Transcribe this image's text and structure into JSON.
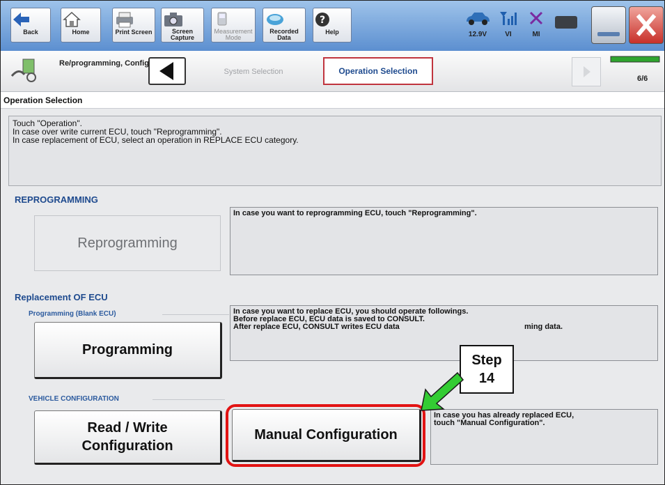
{
  "toolbar": {
    "back_label": "Back",
    "home_label": "Home",
    "print_screen_label": "Print Screen",
    "screen_capture_label": "Screen Capture",
    "measurement_mode_label": "Measurement Mode",
    "recorded_data_label": "Recorded Data",
    "help_label": "Help",
    "battery_voltage": "12.9V",
    "vi_label": "VI",
    "mi_label": "MI"
  },
  "nav": {
    "title": "Re/programming, Configuration",
    "breadcrumb_system": "System Selection",
    "breadcrumb_operation": "Operation Selection",
    "page_indicator": "6/6"
  },
  "section_title": "Operation Selection",
  "instructions": [
    "Touch \"Operation\".",
    "In case over write current ECU, touch \"Reprogramming\".",
    "In case replacement of ECU, select an operation in REPLACE ECU category."
  ],
  "reprogramming": {
    "header": "REPROGRAMMING",
    "button_label": "Reprogramming",
    "description": "In case you want to reprogramming ECU, touch \"Reprogramming\"."
  },
  "replacement": {
    "header": "Replacement OF ECU",
    "programming_group": "Programming (Blank ECU)",
    "programming_button": "Programming",
    "programming_desc": [
      "In case you want to replace ECU, you should operate followings.",
      "Before replace ECU, ECU data is saved to CONSULT.",
      "After replace ECU, CONSULT writes ECU data",
      "ming data."
    ],
    "vehicle_group": "VEHICLE CONFIGURATION",
    "read_write_button_line1": "Read / Write",
    "read_write_button_line2": "Configuration",
    "manual_button": "Manual Configuration",
    "manual_desc": [
      "In case you has already replaced ECU,",
      "touch \"Manual Configuration\"."
    ]
  },
  "callout": {
    "line1": "Step",
    "line2": "14"
  },
  "colors": {
    "header_blue": "#1e4a8e",
    "highlight_red": "#e21313",
    "arrow_green": "#33cc33",
    "breadcrumb_active_border": "#c0343e"
  }
}
